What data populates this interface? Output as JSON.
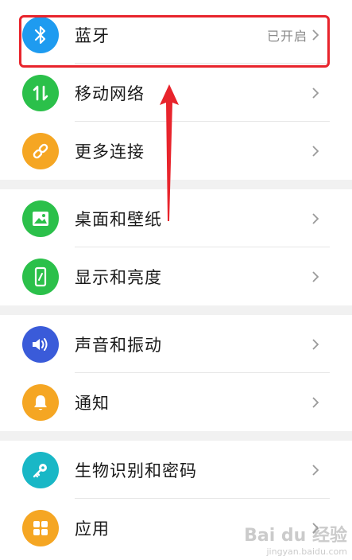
{
  "settings": {
    "items": [
      {
        "label": "蓝牙",
        "status": "已开启",
        "icon": "bluetooth-icon",
        "color": "#1e9bf0"
      },
      {
        "label": "移动网络",
        "status": "",
        "icon": "mobile-data-icon",
        "color": "#2bc04a"
      },
      {
        "label": "更多连接",
        "status": "",
        "icon": "link-icon",
        "color": "#f5a623"
      },
      {
        "label": "桌面和壁纸",
        "status": "",
        "icon": "wallpaper-icon",
        "color": "#2bc04a"
      },
      {
        "label": "显示和亮度",
        "status": "",
        "icon": "display-icon",
        "color": "#2bc04a"
      },
      {
        "label": "声音和振动",
        "status": "",
        "icon": "sound-icon",
        "color": "#3a5bd9"
      },
      {
        "label": "通知",
        "status": "",
        "icon": "notification-icon",
        "color": "#f5a623"
      },
      {
        "label": "生物识别和密码",
        "status": "",
        "icon": "key-icon",
        "color": "#19b7c6"
      },
      {
        "label": "应用",
        "status": "",
        "icon": "apps-icon",
        "color": "#f5a623"
      }
    ]
  },
  "annotation": {
    "highlight_color": "#e8242c"
  },
  "watermark": {
    "main": "Bai du 经验",
    "sub": "jingyan.baidu.com"
  }
}
